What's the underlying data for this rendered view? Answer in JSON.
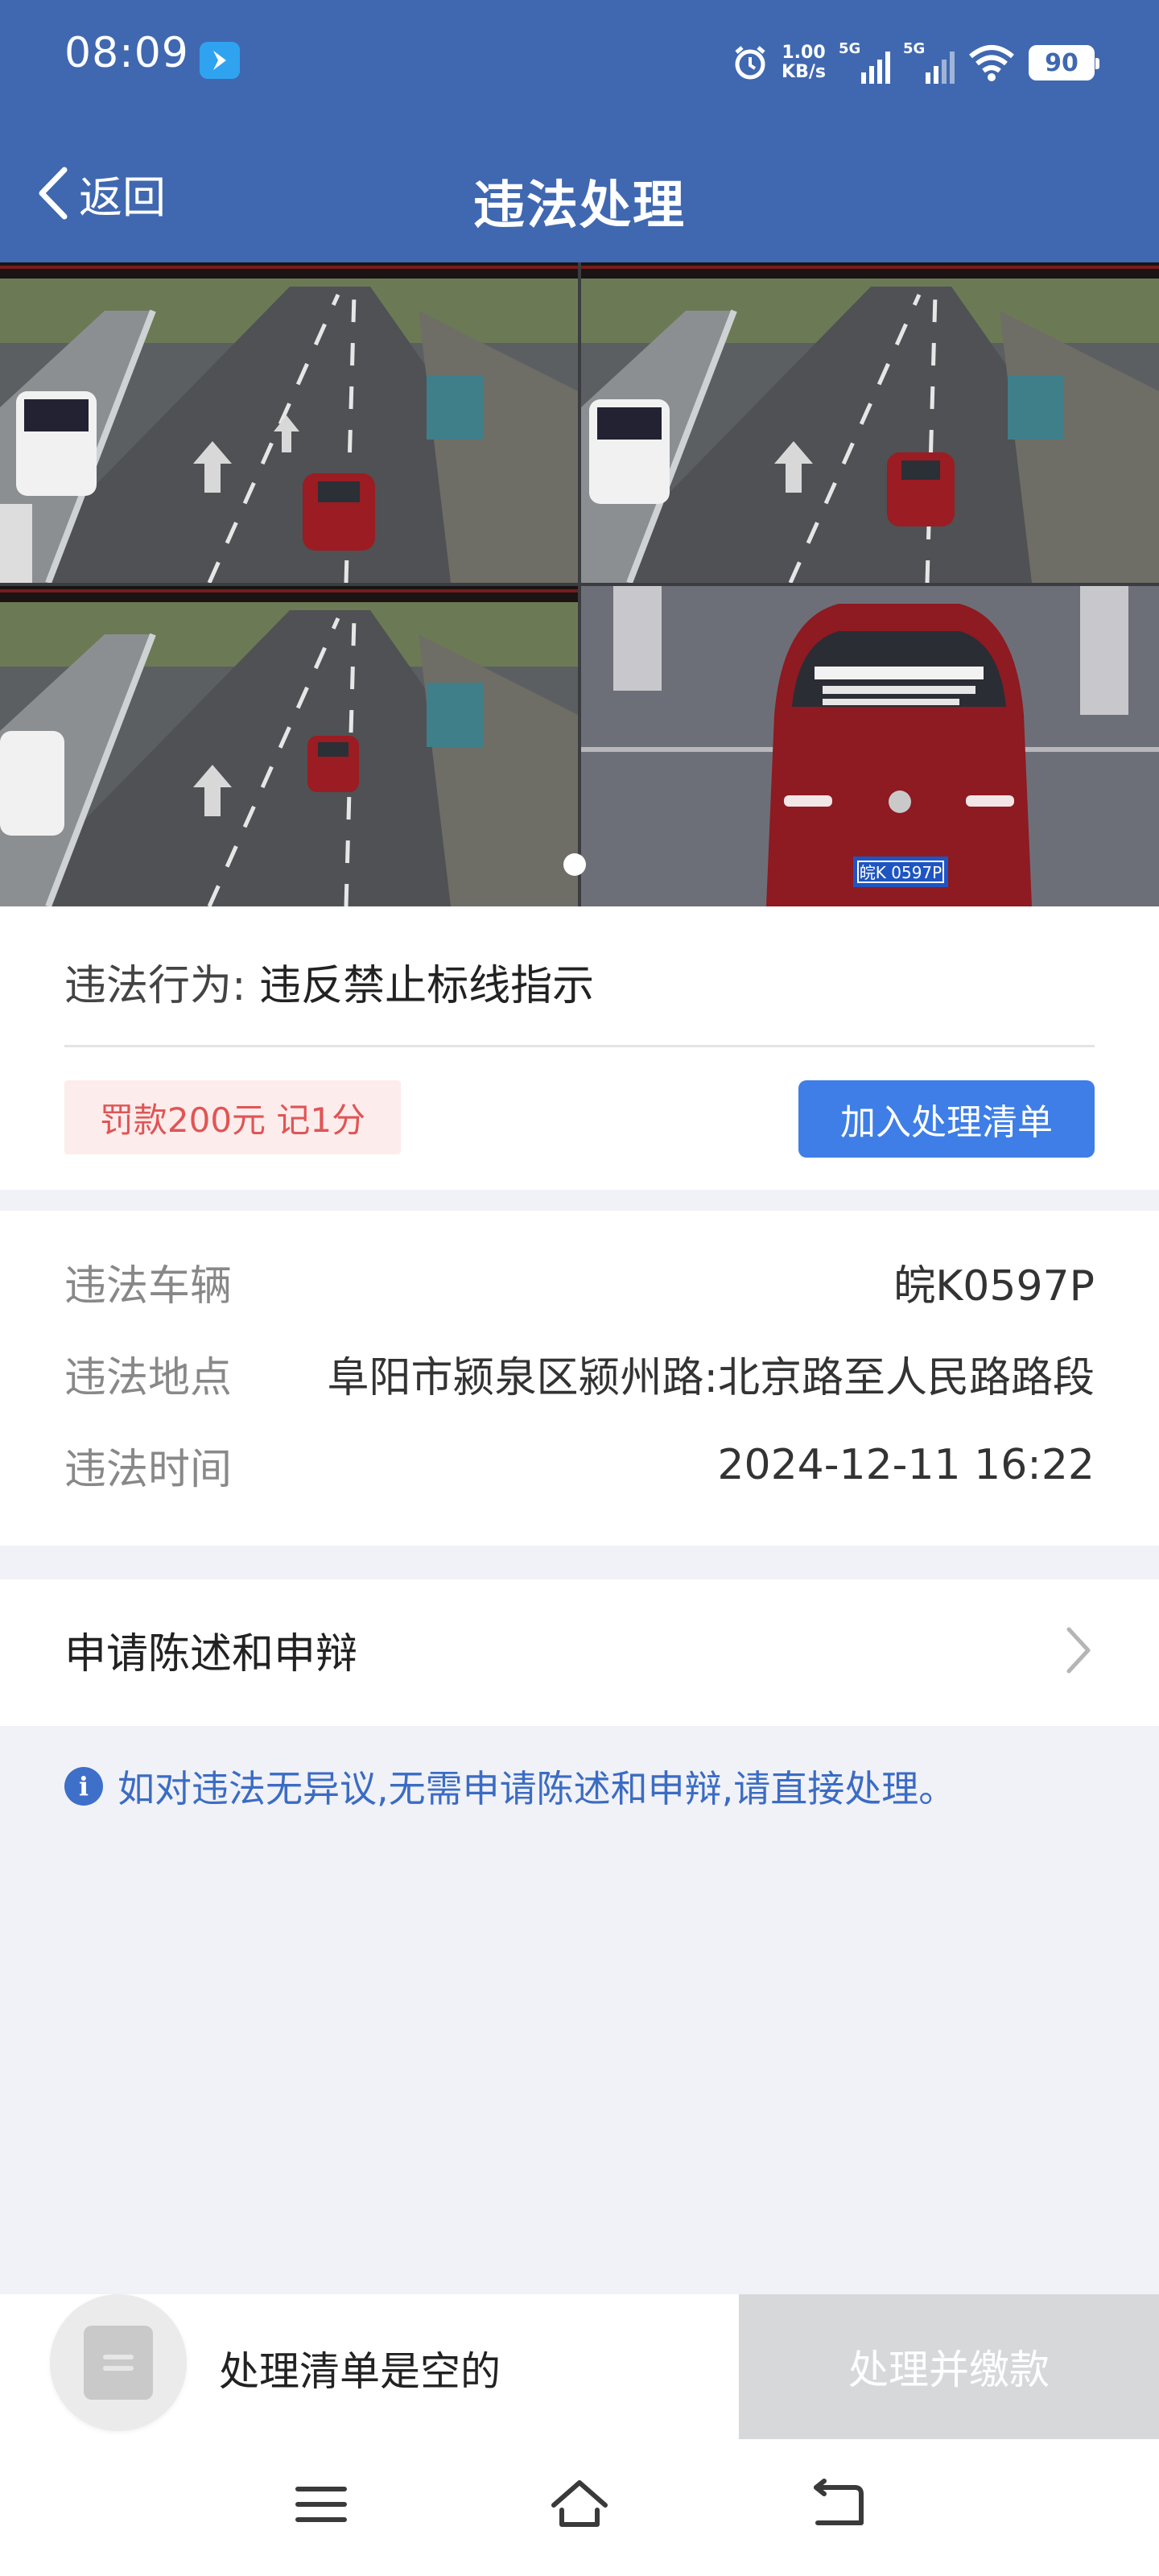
{
  "status_bar": {
    "time": "08:09",
    "net_speed_value": "1.00",
    "net_speed_unit": "KB/s",
    "sim1": "5G",
    "sim2": "5G",
    "battery": "90"
  },
  "nav": {
    "back_label": "返回",
    "title": "违法处理"
  },
  "violation": {
    "behavior_label": "违法行为:",
    "behavior_value": "违反禁止标线指示",
    "penalty": "罚款200元 记1分",
    "add_button": "加入处理清单"
  },
  "details": {
    "vehicle_label": "违法车辆",
    "vehicle_value": "皖K0597P",
    "location_label": "违法地点",
    "location_value": "阜阳市颍泉区颍州路:北京路至人民路路段",
    "time_label": "违法时间",
    "time_value": "2024-12-11 16:22"
  },
  "appeal": {
    "label": "申请陈述和申辩"
  },
  "info": {
    "text": "如对违法无异议,无需申请陈述和申辩,请直接处理。"
  },
  "bottom_bar": {
    "empty_text": "处理清单是空的",
    "pay_button": "处理并缴款"
  },
  "colors": {
    "header": "#4068b0",
    "primary_button": "#3e7ee6",
    "penalty_text": "#e05555",
    "penalty_bg": "#fdecec",
    "disabled_button": "#d7d8da"
  },
  "carousel": {
    "photo_count": 4,
    "active_index": 0,
    "photo_caption_plate": "皖K 0597P"
  }
}
